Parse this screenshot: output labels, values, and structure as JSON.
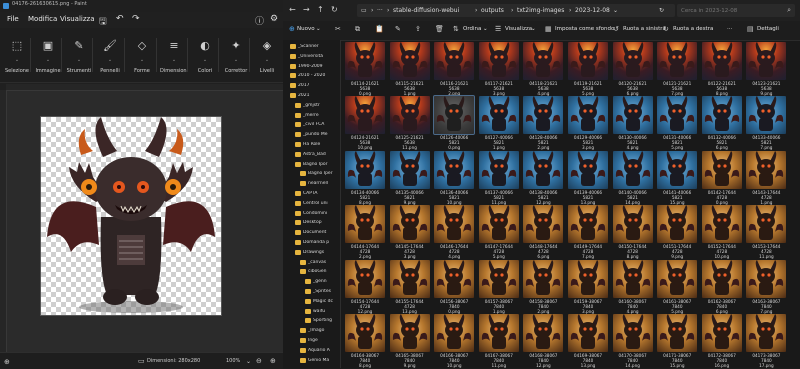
{
  "paint": {
    "title": "04176-261630615.png - Paint",
    "menu": [
      "File",
      "Modifica",
      "Visualizza"
    ],
    "groups": [
      {
        "label": "Selezione",
        "icon": "selection-icon",
        "glyph": "⬚"
      },
      {
        "label": "Immagine",
        "icon": "image-icon",
        "glyph": "▣"
      },
      {
        "label": "Strumenti",
        "icon": "tools-icon",
        "glyph": "✎"
      },
      {
        "label": "Pennelli",
        "icon": "brush-icon",
        "glyph": "🖌"
      },
      {
        "label": "Forme",
        "icon": "shapes-icon",
        "glyph": "◇"
      },
      {
        "label": "Dimensioni",
        "icon": "size-icon",
        "glyph": "≡"
      },
      {
        "label": "Colori",
        "icon": "colors-icon",
        "glyph": "◐"
      },
      {
        "label": "Correttor",
        "icon": "corrector-icon",
        "glyph": "✦"
      },
      {
        "label": "Livelli",
        "icon": "layers-icon",
        "glyph": "◈"
      }
    ],
    "status_dims": "Dimensioni: 280x280",
    "zoom": "100%"
  },
  "explorer": {
    "crumbs": [
      "stable-diffusion-webui",
      "outputs",
      "txt2img-images",
      "2023-12-08"
    ],
    "search_placeholder": "Cerca in 2023-12-08",
    "commands": {
      "new": "Nuovo",
      "sort": "Ordina",
      "view": "Visualizza",
      "set_bg": "Imposta come sfondo",
      "rotate_left": "Ruota a sinistra",
      "rotate_right": "Ruota a destra",
      "details": "Dettagli"
    },
    "tree": [
      {
        "label": "_Scanner",
        "indent": 1
      },
      {
        "label": "_Università",
        "indent": 1
      },
      {
        "label": "1990-2009",
        "indent": 1
      },
      {
        "label": "2010 - 2020",
        "indent": 1
      },
      {
        "label": "2017",
        "indent": 1
      },
      {
        "label": "2021",
        "indent": 1
      },
      {
        "label": "_gmjstr",
        "indent": 2
      },
      {
        "label": "_merre",
        "indent": 2
      },
      {
        "label": "_civil FCA",
        "indent": 2
      },
      {
        "label": "_pundo Me",
        "indent": 2
      },
      {
        "label": "Ha Role",
        "indent": 2
      },
      {
        "label": "Astra_Bad",
        "indent": 2
      },
      {
        "label": "Bagno Ipor",
        "indent": 2
      },
      {
        "label": "Bagno Iper",
        "indent": 3
      },
      {
        "label": "nearrnell",
        "indent": 3
      },
      {
        "label": "CAPTA",
        "indent": 2
      },
      {
        "label": "Centrol uni",
        "indent": 2
      },
      {
        "label": "Condomini",
        "indent": 2
      },
      {
        "label": "Desktop",
        "indent": 2
      },
      {
        "label": "Document",
        "indent": 2
      },
      {
        "label": "Domanda p",
        "indent": 2
      },
      {
        "label": "Drawings",
        "indent": 2
      },
      {
        "label": "_canvas",
        "indent": 3
      },
      {
        "label": "ciboGen",
        "indent": 3
      },
      {
        "label": "_genn",
        "indent": 4
      },
      {
        "label": "_Sprites",
        "indent": 4
      },
      {
        "label": "Magic dc",
        "indent": 4
      },
      {
        "label": "waifu",
        "indent": 4
      },
      {
        "label": "Sporting",
        "indent": 4
      },
      {
        "label": "_Imago",
        "indent": 3
      },
      {
        "label": "Inge",
        "indent": 3
      },
      {
        "label": "Aquario A",
        "indent": 3
      },
      {
        "label": "Genio Ma",
        "indent": 3
      }
    ],
    "rows": [
      {
        "style": "red",
        "captions": [
          "04114-21621\n5638\n0.png",
          "04115-21621\n5638\n1.png",
          "04116-21621\n5638\n2.png",
          "04117-21621\n5638\n3.png",
          "04118-21621\n5638\n4.png",
          "04119-21621\n5638\n5.png",
          "04120-21621\n5638\n6.png",
          "04121-21621\n5638\n7.png",
          "04122-21621\n5638\n8.png",
          "04123-21621\n5638\n9.png"
        ]
      },
      {
        "style": "mixed",
        "captions": [
          "04124-21621\n5638\n10.png",
          "04125-21621\n5638\n11.png",
          "04126-40066\n5821\n0.png",
          "04127-40066\n5821\n1.png",
          "04128-40066\n5821\n2.png",
          "04129-40066\n5821\n3.png",
          "04130-40066\n5821\n4.png",
          "04131-40066\n5821\n5.png",
          "04132-40066\n5821\n6.png",
          "04133-40066\n5821\n7.png"
        ]
      },
      {
        "style": "blue-end",
        "captions": [
          "04134-40066\n5821\n8.png",
          "04135-40066\n5821\n9.png",
          "04136-40066\n5821\n10.png",
          "04137-40066\n5821\n11.png",
          "04138-40066\n5821\n12.png",
          "04139-40066\n5821\n13.png",
          "04140-40066\n5821\n14.png",
          "04141-40066\n5821\n15.png",
          "04142-17644\n4728\n0.png",
          "04143-17644\n4728\n1.png"
        ]
      },
      {
        "style": "gold",
        "captions": [
          "04144-17644\n4728\n2.png",
          "04145-17644\n4728\n3.png",
          "04146-17644\n4728\n4.png",
          "04147-17644\n4728\n5.png",
          "04148-17644\n4728\n6.png",
          "04149-17644\n4728\n7.png",
          "04150-17644\n4728\n8.png",
          "04151-17644\n4728\n9.png",
          "04152-17644\n4728\n10.png",
          "04153-17644\n4728\n11.png"
        ]
      },
      {
        "style": "gold",
        "captions": [
          "04154-17644\n4728\n12.png",
          "04155-17644\n4728\n13.png",
          "04156-38067\n7840\n0.png",
          "04157-38067\n7840\n1.png",
          "04158-38067\n7840\n2.png",
          "04159-38067\n7840\n3.png",
          "04160-38067\n7840\n4.png",
          "04161-38067\n7840\n5.png",
          "04162-38067\n7840\n6.png",
          "04163-38067\n7840\n7.png"
        ]
      },
      {
        "style": "gold",
        "captions": [
          "04164-38067\n7840\n8.png",
          "04165-38067\n7840\n9.png",
          "04166-38067\n7840\n10.png",
          "04167-38067\n7840\n11.png",
          "04168-38067\n7840\n12.png",
          "04169-38067\n7840\n13.png",
          "04170-38067\n7840\n14.png",
          "04171-38067\n7840\n15.png",
          "04172-38067\n7840\n16.png",
          "04173-38067\n7840\n17.png"
        ]
      }
    ]
  },
  "colors": {
    "folder": "#e6b53f",
    "accent": "#3b8ed8"
  }
}
